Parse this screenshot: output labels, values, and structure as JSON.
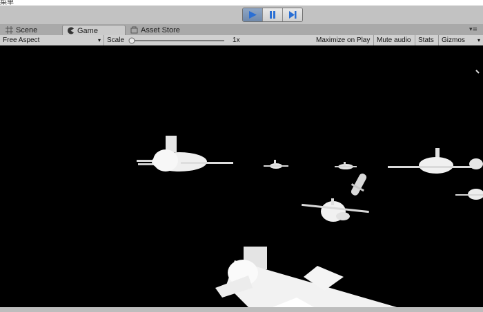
{
  "window": {
    "cut_title": "菜单"
  },
  "playbar": {
    "play_icon": "play-icon",
    "pause_icon": "pause-icon",
    "step_icon": "step-icon",
    "accent_color": "#2a6fd4"
  },
  "tabs": [
    {
      "label": "Scene",
      "icon": "grid-icon"
    },
    {
      "label": "Game",
      "icon": "pacman-icon"
    },
    {
      "label": "Asset Store",
      "icon": "store-icon"
    }
  ],
  "controls": {
    "aspect": "Free Aspect",
    "scale_label": "Scale",
    "scale_value": "1x",
    "maximize": "Maximize on Play",
    "mute": "Mute audio",
    "stats": "Stats",
    "gizmos": "Gizmos"
  },
  "game_view": {
    "background_color": "#000000",
    "object_color": "#ececec"
  }
}
